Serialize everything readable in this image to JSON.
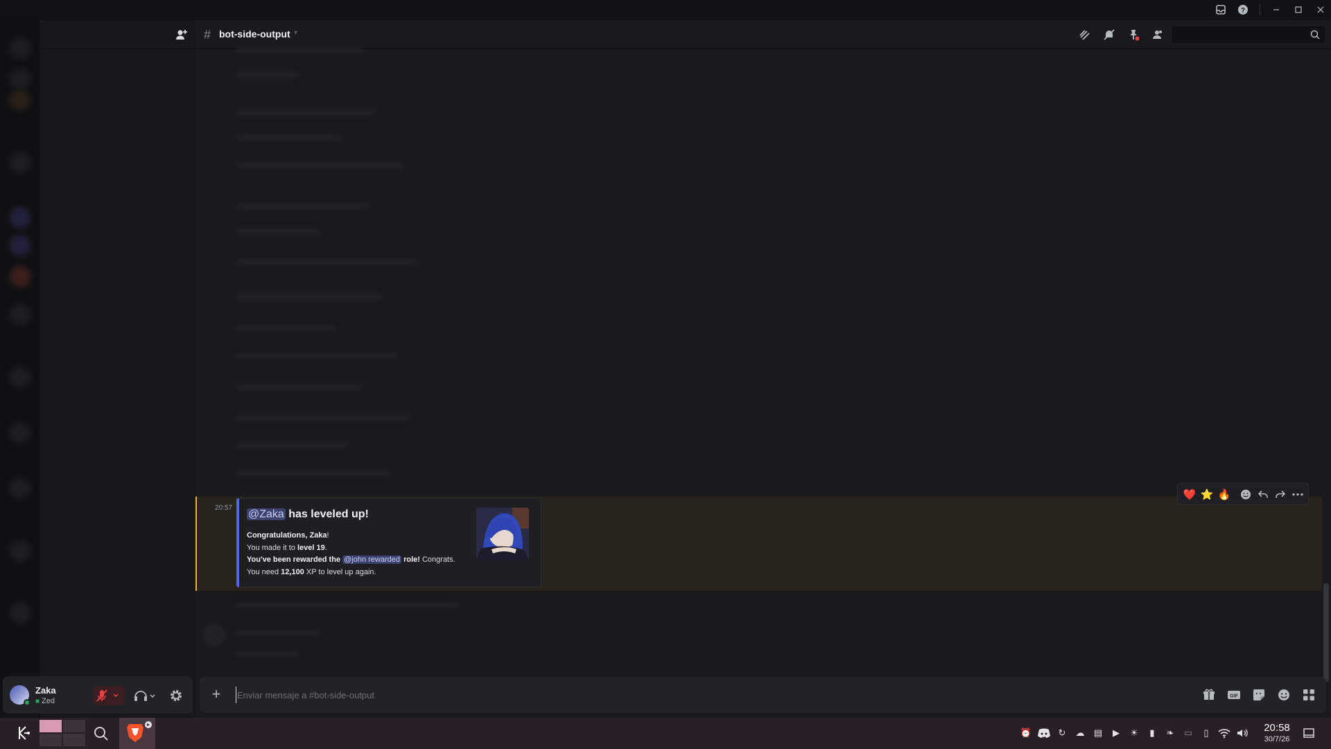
{
  "channel": {
    "name": "bot-side-output"
  },
  "message": {
    "time": "20:57",
    "title_mention": "@Zaka",
    "title_rest": " has leveled up!",
    "line1_bold": "Congratulations, Zaka",
    "line1_end": "!",
    "line2_a": "You made it to ",
    "line2_bold": "level 19",
    "line2_end": ".",
    "line3_bold_a": "You've been rewarded the ",
    "line3_mention": "@john rewarded",
    "line3_bold_b": " role!",
    "line3_end": " Congrats.",
    "line4_a": "You need ",
    "line4_bold": "12,100",
    "line4_end": " XP to level up again."
  },
  "reactions": [
    "❤️",
    "⭐",
    "🔥"
  ],
  "composer": {
    "placeholder": "Enviar mensaje a #bot-side-output"
  },
  "user": {
    "name": "Zaka",
    "status": "Zed"
  },
  "clock": {
    "time": "20:58",
    "date": "30/7/26"
  },
  "colors": {
    "accent": "#5865f2",
    "highlight": "#f0b232",
    "mute": "#ed4245",
    "online": "#23a55a"
  }
}
